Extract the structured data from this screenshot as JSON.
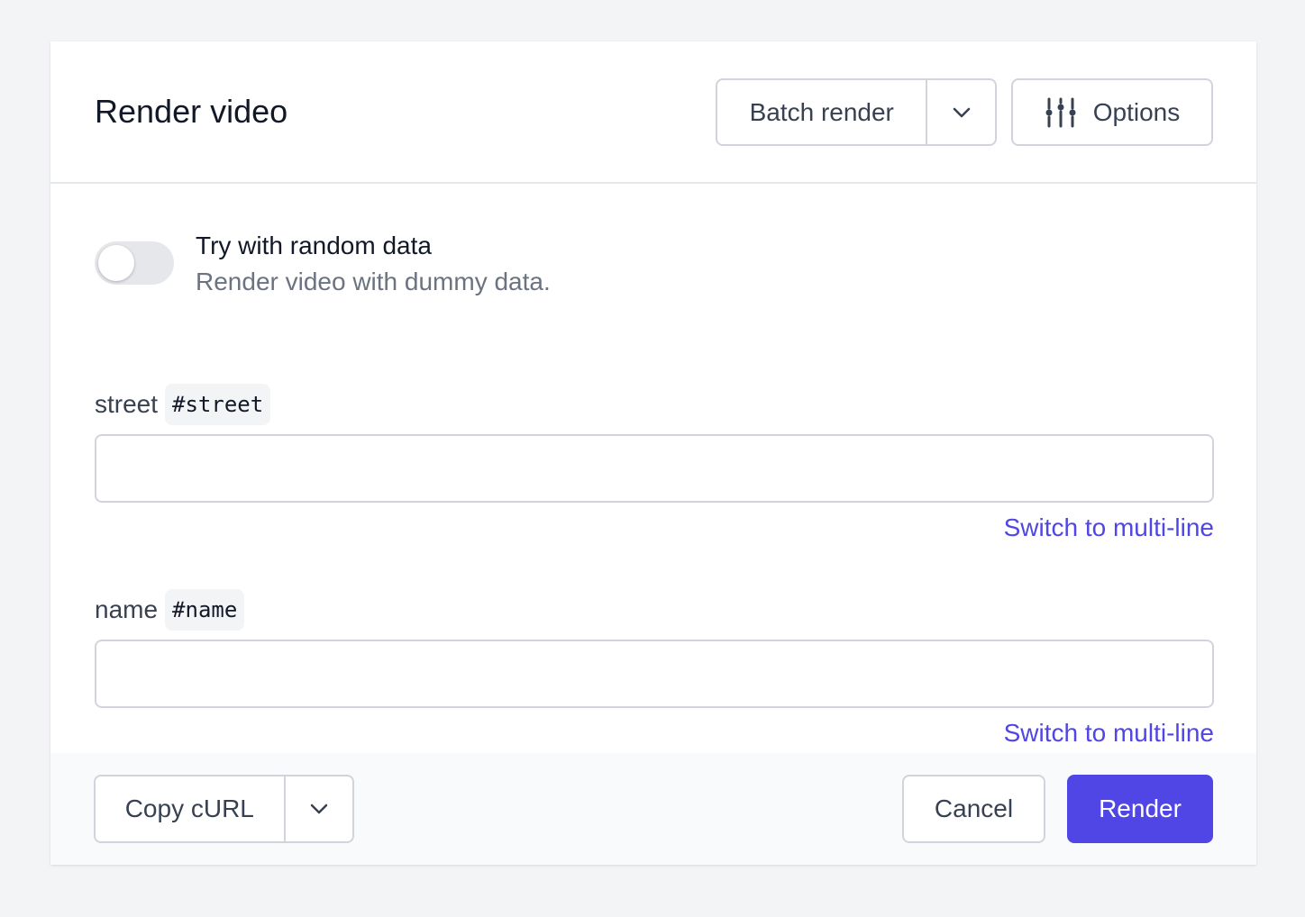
{
  "header": {
    "title": "Render video",
    "batch_render_label": "Batch render",
    "options_label": "Options"
  },
  "random_data": {
    "title": "Try with random data",
    "description": "Render video with dummy data.",
    "enabled": false
  },
  "fields": [
    {
      "label": "street",
      "tag": "#street",
      "value": "",
      "switch_label": "Switch to multi-line"
    },
    {
      "label": "name",
      "tag": "#name",
      "value": "",
      "switch_label": "Switch to multi-line"
    }
  ],
  "footer": {
    "copy_curl_label": "Copy cURL",
    "cancel_label": "Cancel",
    "render_label": "Render"
  },
  "colors": {
    "accent": "#4f46e5",
    "background": "#f3f4f6",
    "border": "#d1d5db"
  },
  "icons": {
    "chevron": "chevron-down-icon",
    "options": "sliders-icon"
  }
}
